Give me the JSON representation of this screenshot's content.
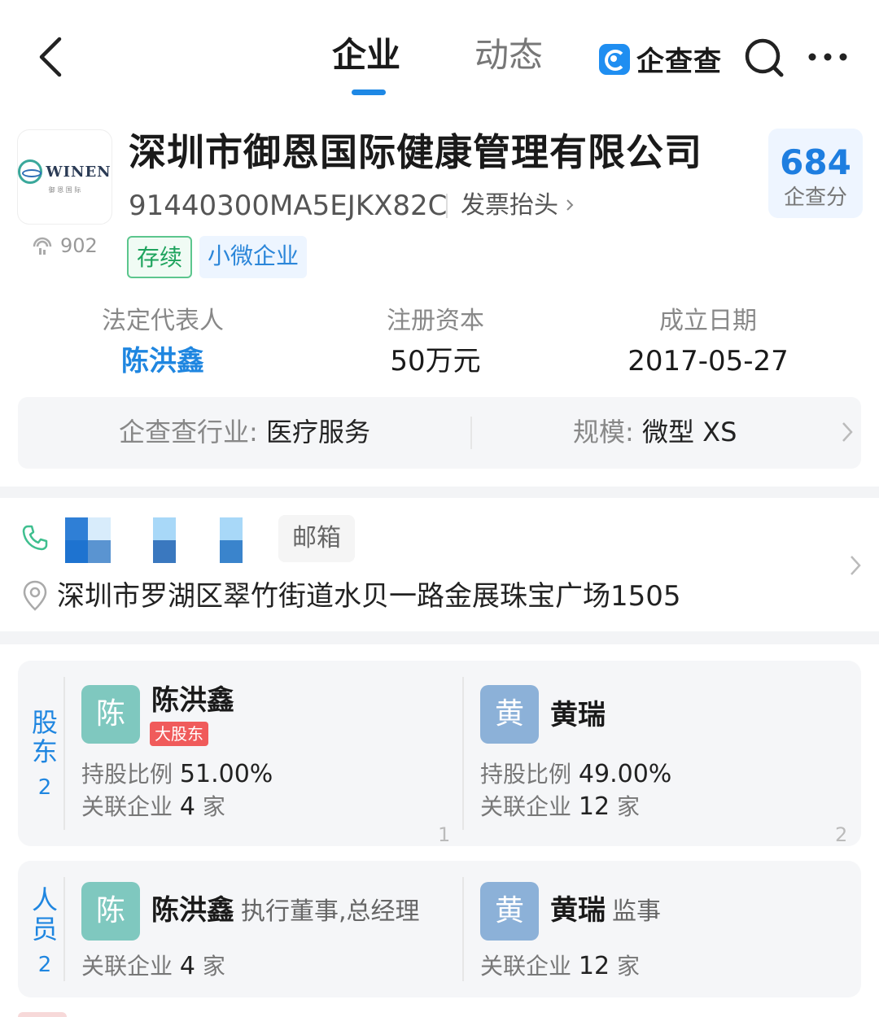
{
  "nav": {
    "tabs": [
      {
        "label": "企业",
        "active": true
      },
      {
        "label": "动态",
        "active": false
      }
    ],
    "brand": "企查查",
    "icons": [
      "back-arrow-icon",
      "search-icon",
      "more-icon"
    ],
    "accent_color": "#1e88e5"
  },
  "company": {
    "logo_text": "WINEN",
    "logo_sub": "御 恩 国 际",
    "name": "深圳市御恩国际健康管理有限公司",
    "credit_code": "91440300MA5EJKX82C",
    "invoice_label": "发票抬头",
    "views": "902",
    "score": "684",
    "score_label": "企查分",
    "tags": [
      "存续",
      "小微企业"
    ]
  },
  "facts": {
    "legal_rep_label": "法定代表人",
    "legal_rep": "陈洪鑫",
    "capital_label": "注册资本",
    "capital": "50万元",
    "founded_label": "成立日期",
    "founded": "2017-05-27"
  },
  "industry": {
    "industry_key": "企查查行业:",
    "industry_val": "医疗服务",
    "scale_key": "规模:",
    "scale_val": "微型 XS"
  },
  "contact": {
    "email_label": "邮箱",
    "address": "深圳市罗湖区翠竹街道水贝一路金展珠宝广场1505"
  },
  "shareholders": {
    "label": "股东",
    "count": "2",
    "items": [
      {
        "avatar": "陈",
        "name": "陈洪鑫",
        "badge": "大股东",
        "ratio_label": "持股比例",
        "ratio": "51.00%",
        "related_label": "关联企业",
        "related_count": "4",
        "related_unit": "家",
        "index": "1"
      },
      {
        "avatar": "黄",
        "name": "黄瑞",
        "ratio_label": "持股比例",
        "ratio": "49.00%",
        "related_label": "关联企业",
        "related_count": "12",
        "related_unit": "家",
        "index": "2"
      }
    ]
  },
  "staff": {
    "label": "人员",
    "count": "2",
    "items": [
      {
        "avatar": "陈",
        "name": "陈洪鑫",
        "role": "执行董事,总经理",
        "related_label": "关联企业",
        "related_count": "4",
        "related_unit": "家"
      },
      {
        "avatar": "黄",
        "name": "黄瑞",
        "role": "监事",
        "related_label": "关联企业",
        "related_count": "12",
        "related_unit": "家"
      }
    ]
  }
}
